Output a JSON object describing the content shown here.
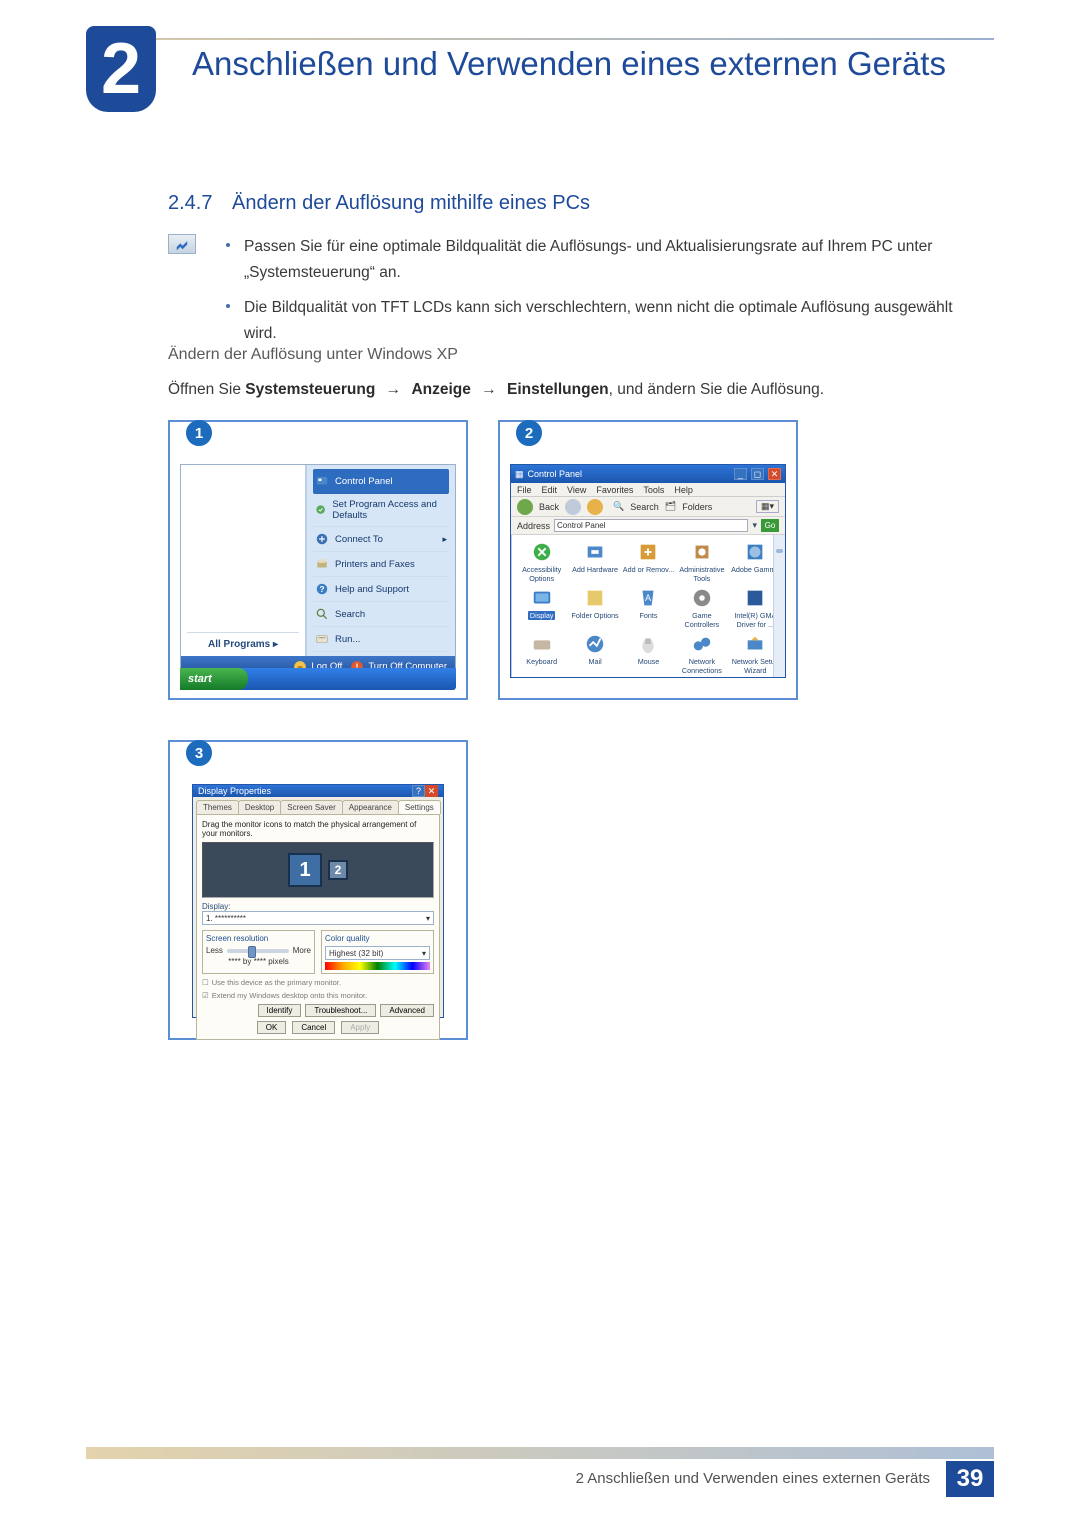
{
  "chapter": {
    "number": "2",
    "title": "Anschließen und Verwenden eines externen Geräts"
  },
  "section": {
    "number": "2.4.7",
    "title": "Ändern der Auflösung mithilfe eines PCs"
  },
  "notes": [
    "Passen Sie für eine optimale Bildqualität die Auflösungs- und Aktualisierungsrate auf Ihrem PC unter „Systemsteuerung“ an.",
    "Die Bildqualität von TFT LCDs kann sich verschlechtern, wenn nicht die optimale Auflösung ausgewählt wird."
  ],
  "subheading": "Ändern der Auflösung unter Windows XP",
  "instruction": {
    "prefix": "Öffnen Sie ",
    "path": [
      "Systemsteuerung",
      "Anzeige",
      "Einstellungen"
    ],
    "arrow": "→",
    "suffix": ", und ändern Sie die Auflösung."
  },
  "stepBadges": {
    "s1": "1",
    "s2": "2",
    "s3": "3"
  },
  "startMenu": {
    "items": [
      {
        "label": "Control Panel"
      },
      {
        "label": "Set Program Access and Defaults"
      },
      {
        "label": "Connect To",
        "hasSub": true
      },
      {
        "label": "Printers and Faxes"
      },
      {
        "label": "Help and Support"
      },
      {
        "label": "Search"
      },
      {
        "label": "Run..."
      }
    ],
    "allPrograms": "All Programs",
    "logOff": "Log Off",
    "turnOff": "Turn Off Computer",
    "startLabel": "start"
  },
  "controlPanel": {
    "title": "Control Panel",
    "menus": [
      "File",
      "Edit",
      "View",
      "Favorites",
      "Tools",
      "Help"
    ],
    "toolbar": {
      "back": "Back",
      "search": "Search",
      "folders": "Folders"
    },
    "addressLabel": "Address",
    "addressValue": "Control Panel",
    "goLabel": "Go",
    "icons": [
      {
        "label": "Accessibility Options"
      },
      {
        "label": "Add Hardware"
      },
      {
        "label": "Add or Remov..."
      },
      {
        "label": "Administrative Tools"
      },
      {
        "label": "Adobe Gamma"
      },
      {
        "label": "Display",
        "selected": true
      },
      {
        "label": "Folder Options"
      },
      {
        "label": "Fonts"
      },
      {
        "label": "Game Controllers"
      },
      {
        "label": "Intel(R) GMA Driver for ..."
      },
      {
        "label": "Keyboard"
      },
      {
        "label": "Mail"
      },
      {
        "label": "Mouse"
      },
      {
        "label": "Network Connections"
      },
      {
        "label": "Network Setup Wizard"
      }
    ]
  },
  "displayProps": {
    "title": "Display Properties",
    "tabs": [
      "Themes",
      "Desktop",
      "Screen Saver",
      "Appearance",
      "Settings"
    ],
    "activeTab": 4,
    "hint": "Drag the monitor icons to match the physical arrangement of your monitors.",
    "monitor1": "1",
    "monitor2": "2",
    "displayLabel": "Display:",
    "displayValue": "1. **********",
    "resBoxTitle": "Screen resolution",
    "less": "Less",
    "more": "More",
    "resText": "**** by **** pixels",
    "colorBoxTitle": "Color quality",
    "colorValue": "Highest (32 bit)",
    "check1": "Use this device as the primary monitor.",
    "check2": "Extend my Windows desktop onto this monitor.",
    "btnIdentify": "Identify",
    "btnTrouble": "Troubleshoot...",
    "btnAdvanced": "Advanced",
    "btnOK": "OK",
    "btnCancel": "Cancel",
    "btnApply": "Apply"
  },
  "footer": {
    "text": "2 Anschließen und Verwenden eines externen Geräts",
    "page": "39"
  }
}
